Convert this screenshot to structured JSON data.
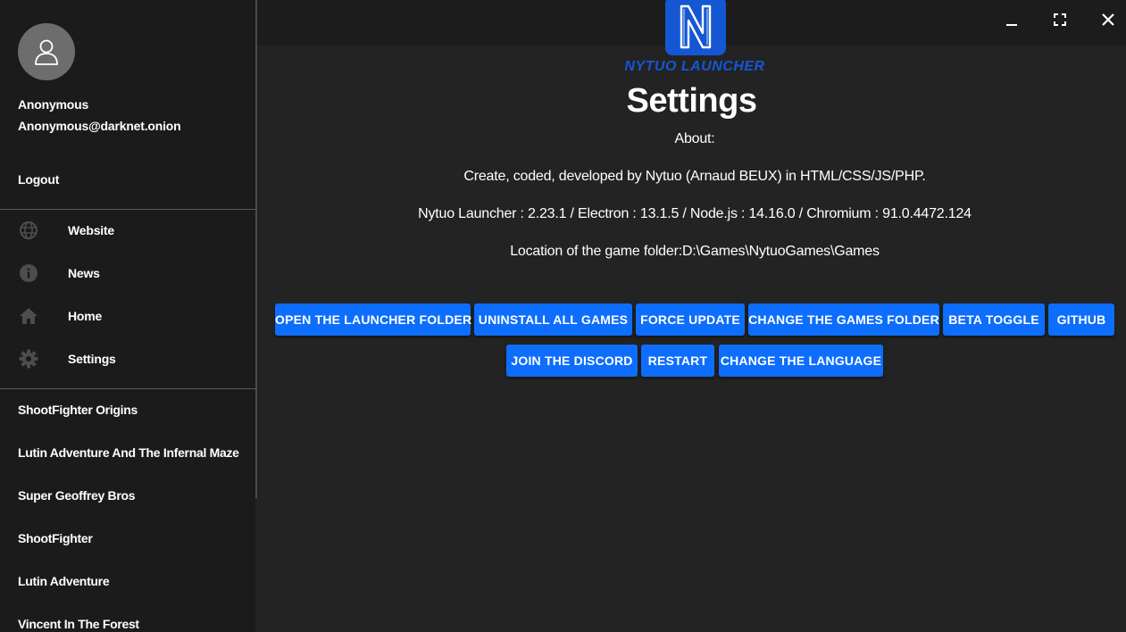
{
  "user": {
    "name": "Anonymous",
    "email": "Anonymous@darknet.onion",
    "logout_label": "Logout"
  },
  "nav": {
    "items": [
      {
        "label": "Website",
        "icon": "globe-icon"
      },
      {
        "label": "News",
        "icon": "info-icon"
      },
      {
        "label": "Home",
        "icon": "home-icon"
      },
      {
        "label": "Settings",
        "icon": "gear-icon"
      }
    ]
  },
  "games": [
    "ShootFighter Origins",
    "Lutin Adventure And The Infernal Maze",
    "Super Geoffrey Bros",
    "ShootFighter",
    "Lutin Adventure",
    "Vincent In The Forest"
  ],
  "logo": {
    "text": "NYTUO LAUNCHER"
  },
  "page": {
    "title": "Settings",
    "about_label": "About:",
    "credits": "Create, coded, developed by Nytuo (Arnaud BEUX) in HTML/CSS/JS/PHP.",
    "versions": "Nytuo Launcher : 2.23.1 / Electron : 13.1.5 / Node.js : 14.16.0 / Chromium : 91.0.4472.124",
    "location": "Location of the game folder:D:\\Games\\NytuoGames\\Games"
  },
  "buttons": {
    "open_launcher_folder": "OPEN THE LAUNCHER FOLDER",
    "uninstall_all": "UNINSTALL ALL GAMES",
    "force_update": "FORCE UPDATE",
    "change_games_folder": "CHANGE THE GAMES FOLDER",
    "beta_toggle": "BETA TOGGLE",
    "github": "GITHUB",
    "join_discord": "JOIN THE DISCORD",
    "restart": "RESTART",
    "change_language": "CHANGE THE LANGUAGE"
  },
  "colors": {
    "accent": "#0d6efd",
    "logo_blue": "#1557d3",
    "background": "#232323",
    "sidebar": "#1b1b1b"
  }
}
